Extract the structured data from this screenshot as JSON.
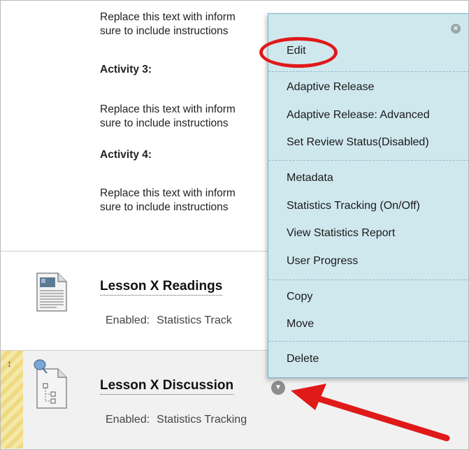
{
  "content": {
    "para_line1": "Replace this text with inform",
    "para_line2": "sure to include instructions",
    "para_line3": "Replace this text with inform",
    "para_line4": "sure to include instructions",
    "para_line5": "Replace this text with inform",
    "para_line6": "sure to include instructions",
    "activity3_heading": "Activity 3:",
    "activity4_heading": "Activity 4:"
  },
  "items": [
    {
      "title": "Lesson X Readings",
      "meta_label": "Enabled:",
      "meta_value": "Statistics Track"
    },
    {
      "title": "Lesson X Discussion",
      "meta_label": "Enabled:",
      "meta_value": "Statistics Tracking"
    }
  ],
  "context_menu": {
    "close_icon": "close-icon",
    "groups": [
      [
        "Edit"
      ],
      [
        "Adaptive Release",
        "Adaptive Release: Advanced",
        "Set Review Status(Disabled)"
      ],
      [
        "Metadata",
        "Statistics Tracking (On/Off)",
        "View Statistics Report",
        "User Progress"
      ],
      [
        "Copy",
        "Move"
      ],
      [
        "Delete"
      ]
    ]
  },
  "colors": {
    "menu_bg": "#cfe8ee",
    "annotation_red": "#e01919",
    "drag_hatch": "#f5e9a8"
  }
}
